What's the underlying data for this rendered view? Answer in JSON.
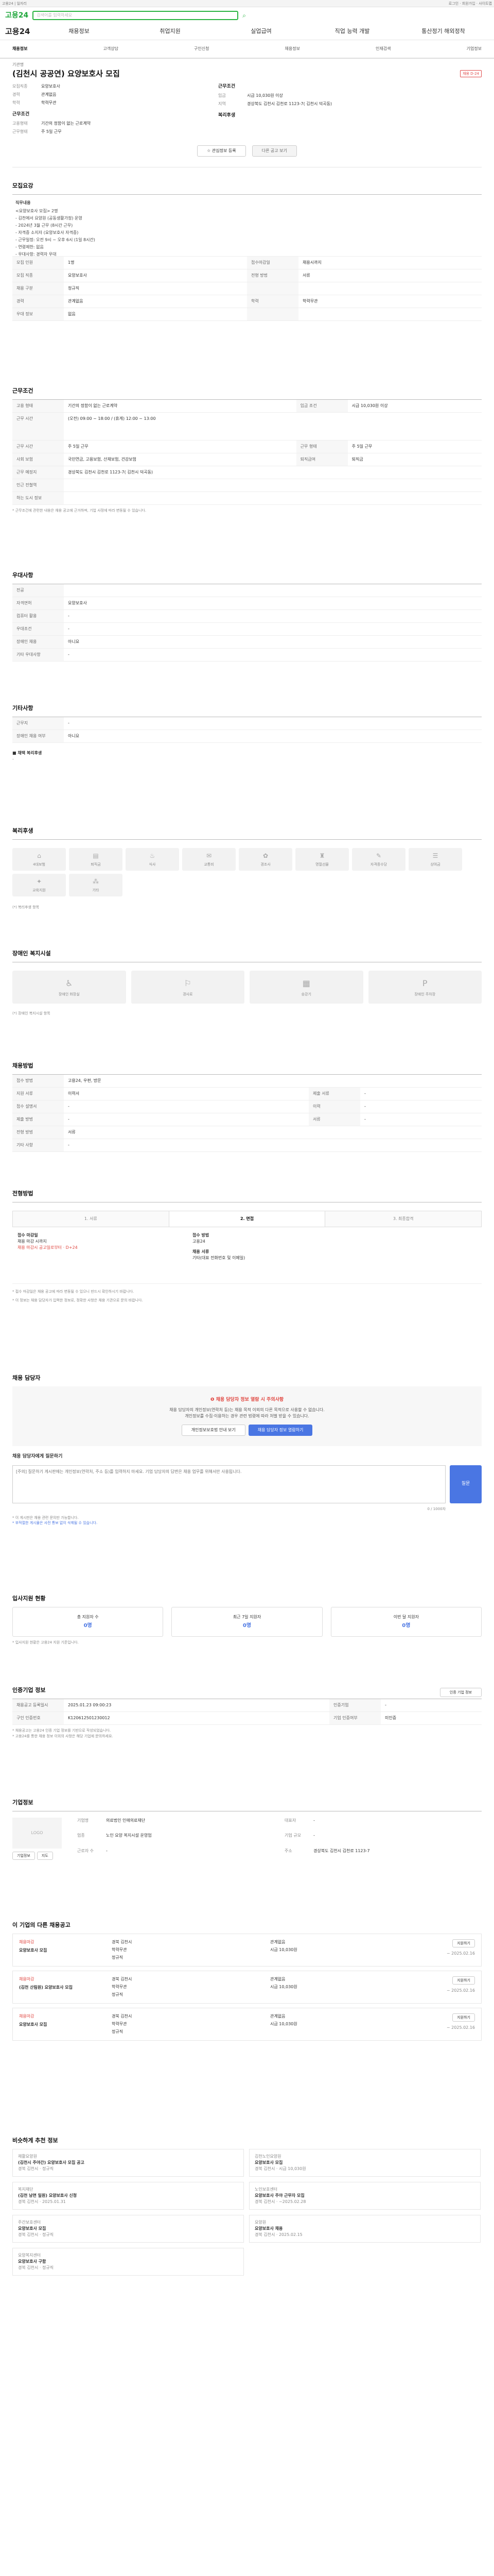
{
  "top": {
    "left": "고용24 | 일자리",
    "right": "로그인 · 회원가입 · 사이트맵"
  },
  "header": {
    "logo": "고용24",
    "search_placeholder": "검색어를 입력하세요",
    "brand": "고용24"
  },
  "gnb": [
    "채용정보",
    "취업지원",
    "실업급여",
    "직업 능력 개발",
    "통산정기 해외정착"
  ],
  "tabs": [
    "채용정보",
    "고객상담",
    "구인신청",
    "채용정보",
    "인재검색",
    "기업정보"
  ],
  "job": {
    "sub": "기관명",
    "title": "(김천시 공공연) 요양보호사 모집",
    "badge": "채용 D-24",
    "left": [
      {
        "k": "모집직종",
        "v": "요양보호사"
      },
      {
        "k": "경력",
        "v": "관계없음"
      },
      {
        "k": "학력",
        "v": "학력무관"
      }
    ],
    "left2_title": "근무조건",
    "left2": [
      {
        "k": "고용형태",
        "v": "기간의 정함이 없는 근로계약"
      },
      {
        "k": "근무형태",
        "v": "주 5일 근무"
      }
    ],
    "right_title": "근무조건",
    "right": [
      {
        "k": "임금",
        "v": "시급 10,030원 이상"
      },
      {
        "k": "지역",
        "v": "경상북도 김천시 김천로 1123-7( 김천시 덕곡동)"
      }
    ],
    "right2_title": "복리후생",
    "right2": [
      {
        "k": "",
        "v": ""
      }
    ],
    "btn_apply": "관심정보 등록",
    "btn_mail": "다른 공고 보기"
  },
  "s_recruit": {
    "title": "모집요강",
    "head": "직무내용",
    "lines": [
      "<요양보호사 모집> 2명",
      "- 김천에서 요양원 (공동생활가정) 운영",
      "- 2024년 3월 근무 (8시간 근무)",
      "- 자격증 소지자 (요양보호사 자격증)",
      "- 근무일정: 오전 9시 ~ 오후 6시 (1일 8시간)",
      "- 연령제한: 없음",
      "- 우대사항: 경력자 우대"
    ],
    "rows": [
      [
        "모집 인원",
        "1명",
        "접수마감일",
        "채용시까지"
      ],
      [
        "모집 직종",
        "요양보호사",
        "전형 방법",
        "서류"
      ],
      [
        "채용 구분",
        "정규직",
        "",
        " "
      ],
      [
        "경력",
        "관계없음",
        "학력",
        "학력무관"
      ],
      [
        "우대 정보",
        "없음",
        "",
        ""
      ]
    ]
  },
  "s_cond": {
    "title": "근무조건",
    "rows": [
      [
        "고용 형태",
        "기간의 정함이 없는 근로계약",
        "임금 조건",
        "시급 10,030원 이상"
      ],
      [
        "근무 시간",
        "(오전) 09:00 ~ 18:00 / (휴게) 12:00 ~ 13:00",
        "",
        ""
      ],
      [
        "근무 시간",
        "주 5일 근무",
        "근무 형태",
        "주 5일 근무"
      ],
      [
        "사회 보험",
        "국민연금, 고용보험, 산재보험, 건강보험",
        "퇴직급여",
        "퇴직금"
      ],
      [
        "근무 예정지",
        "경상북도 김천시 김천로 1123-7( 김천시 덕곡동)",
        "",
        ""
      ],
      [
        "인근 전철역",
        "",
        "",
        " "
      ],
      [
        "하는 도시 정보",
        "",
        "",
        " "
      ]
    ],
    "note": "* 근무조건에 관련한 내용은 채용 공고에 근거하며, 기업 사정에 따라 변동될 수 있습니다."
  },
  "s_pref": {
    "title": "우대사항",
    "rows": [
      [
        "전공",
        ""
      ],
      [
        "자격면허",
        "요양보호사"
      ],
      [
        "컴퓨터 활용",
        "-"
      ],
      [
        "우대조건",
        "-"
      ],
      [
        "장애인 채용",
        "아니요"
      ],
      [
        "기타 우대사항",
        "-"
      ]
    ]
  },
  "s_etc": {
    "title": "기타사항",
    "rows": [
      [
        "근무지",
        "-"
      ],
      [
        "장애인 채용 여부",
        "아니요"
      ]
    ],
    "sub": "■ 채택 복리후생",
    "sub_v": "-"
  },
  "s_welfare": {
    "title": "복리후생",
    "cards": [
      [
        "4대보험",
        "⌂"
      ],
      [
        "퇴직금",
        "▤"
      ],
      [
        "식사",
        "♨"
      ],
      [
        "교통비",
        "✉"
      ],
      [
        "경조사",
        "✿"
      ],
      [
        "명절선물",
        "♜"
      ],
      [
        "자격증수당",
        "✎"
      ],
      [
        "상여금",
        "☰"
      ],
      [
        "교육지원",
        "✦"
      ],
      [
        "기타",
        "⁂"
      ]
    ],
    "note": "(*) 복리후생 항목"
  },
  "s_disab": {
    "title": "장애인 복지시설",
    "cards": [
      [
        "장애인 화장실",
        "♿"
      ],
      [
        "경사로",
        "⚐"
      ],
      [
        "승강기",
        "▦"
      ],
      [
        "장애인 주차장",
        "P"
      ]
    ],
    "note": "(*) 장애인 복지시설 항목"
  },
  "s_method": {
    "title": "채용방법",
    "rows": [
      [
        "접수 방법",
        "고용24, 우편, 방문",
        "",
        " "
      ],
      [
        "지원 서류",
        "이력서",
        "제출 서류",
        "-"
      ],
      [
        "접수 설명서",
        "-",
        "이력",
        "-"
      ],
      [
        "제출 방법",
        "-",
        "서류",
        "-"
      ],
      [
        "전형 방법",
        "서류",
        "",
        ""
      ],
      [
        "기타 사항",
        "-",
        "",
        ""
      ]
    ]
  },
  "s_process": {
    "title": "전형방법",
    "steps": [
      "1. 서류",
      "2. 면접",
      "3. 최종합격"
    ],
    "info": {
      "k1": "접수 마감일",
      "v1": "채용 마감 시까지",
      "red": "채용 마감시 공고일로부터 · D+24",
      "k2": "접수 방법",
      "v2": "고용24",
      "k3": "채용 서류",
      "v3": "기타(대표 전화번호 및 이메일)"
    },
    "notes": [
      "* 접수 마감일은 채용 공고에 따라 변동될 수 있으니 반드시 확인하시기 바랍니다.",
      "* 이 정보는 채용 담당자가 입력한 정보로, 정확한 사항은 채용 기관으로 문의 바랍니다."
    ]
  },
  "s_contact": {
    "title": "채용 담당자",
    "hl": "❶ 채용 담당자 정보 열람 시 주의사항",
    "p1": "채용 담당자의 개인정보(연락처 등)는 채용 목적 이외의 다른 목적으로 사용할 수 없습니다.",
    "p2": "개인정보를 수집·이용하는 경우 관련 법령에 따라 처벌 받을 수 있습니다.",
    "b1": "개인정보보호법 안내 보기",
    "b2": "채용 담당자 정보 열람하기",
    "qtitle": "채용 담당자에게 질문하기",
    "qplaceholder": "[주의] 질문하기 게시판에는 개인정보(연락처, 주소 등)를 입력하지 마세요. 기업 담당자의 답변은 채용 업무를 위해서만 사용됩니다.",
    "qcount": "0 / 1000자",
    "send": "질문",
    "n1": "* 이 게시판은 채용 관련 문의만 가능합니다.",
    "n2": "* 부적절한 게시물은 사전 통보 없이 삭제될 수 있습니다."
  },
  "s_stats": {
    "title": "입사지원 현황",
    "items": [
      [
        "총 지원자 수",
        "0명"
      ],
      [
        "최근 7일 지원자",
        "0명"
      ],
      [
        "이번 달 지원자",
        "0명"
      ]
    ],
    "note": "* 입사지원 현황은 고용24 지원 기준입니다."
  },
  "s_manage": {
    "title": "인증기업 정보",
    "btn": "인증 기업 정보",
    "rows": [
      [
        "채용공고 등록일시",
        "2025.01.23 09:00:23",
        "인증기업",
        "-"
      ],
      [
        "구인 인증번호",
        "K120612501230012",
        "기업 인증여부",
        "미인증"
      ]
    ],
    "notes": [
      "* 채용공고는 고용24 인증 기업 정보를 기반으로 작성되었습니다.",
      "* 고용24를 통한 채용 정보 이외의 사항은 해당 기업에 문의하세요."
    ]
  },
  "s_company": {
    "title": "기업정보",
    "logo": "LOGO",
    "b1": "기업정보",
    "b2": "지도",
    "rows": [
      [
        "기업명",
        "의료법인 인애의료재단"
      ],
      [
        "대표자",
        "-"
      ],
      [
        "업종",
        "노인 요양 복지시설 운영업"
      ],
      [
        "기업 규모",
        "-"
      ],
      [
        "근로자 수",
        "-"
      ],
      [
        "주소",
        "경상북도 김천시 김천로 1123-7"
      ]
    ]
  },
  "s_same": {
    "title": "이 기업의 다른 채용공고",
    "items": [
      {
        "tag": "채용마감",
        "title": "요양보호사 모집",
        "loc": "경북 김천시",
        "career": "관계없음",
        "edu": "학력무관",
        "pay": "시급 10,030원",
        "type": "정규직",
        "date": "~ 2025.02.16"
      },
      {
        "tag": "채용마감",
        "title": "(김천 산림원) 요양보호사 모집",
        "loc": "경북 김천시",
        "career": "관계없음",
        "edu": "학력무관",
        "pay": "시급 10,030원",
        "type": "정규직",
        "date": "~ 2025.02.16"
      },
      {
        "tag": "채용마감",
        "title": "요양보호사 모집",
        "loc": "경북 김천시",
        "career": "관계없음",
        "edu": "학력무관",
        "pay": "시급 10,030원",
        "type": "정규직",
        "date": "~ 2025.02.16"
      }
    ],
    "apply": "지원하기"
  },
  "s_rec": {
    "title": "비슷하게 추천 정보",
    "items": [
      {
        "org": "재활요양원",
        "title": "(김천시 주야간) 요양보호사 모집 공고",
        "meta": "경북 김천시 · 정규직"
      },
      {
        "org": "김천노인요양원",
        "title": "요양보호사 모집",
        "meta": "경북 김천시 · 시급 10,030원"
      },
      {
        "org": "복지재단",
        "title": "(김천 남면 일원) 요양보호사 신청",
        "meta": "경북 김천시 · 2025.01.31"
      },
      {
        "org": "노인보호센터",
        "title": "요양보호사 주야 근무자 모집",
        "meta": "경북 김천시 · ~2025.02.28"
      },
      {
        "org": "주간보호센터",
        "title": "요양보호사 모집",
        "meta": "경북 김천시 · 정규직"
      },
      {
        "org": "요양원",
        "title": "요양보호사 채용",
        "meta": "경북 김천시 · 2025.02.15"
      },
      {
        "org": "요양복지센터",
        "title": "요양보호사 구함",
        "meta": "경북 김천시 · 정규직"
      }
    ]
  }
}
